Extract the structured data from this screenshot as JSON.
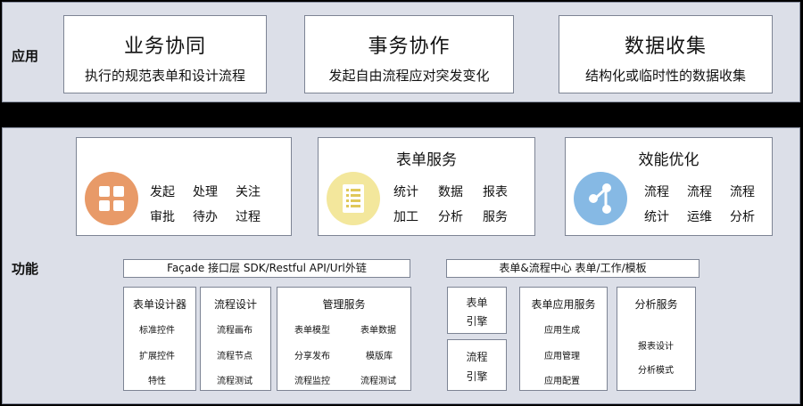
{
  "application": {
    "label": "应用",
    "cards": [
      {
        "title": "业务协同",
        "subtitle": "执行的规范表单和设计流程"
      },
      {
        "title": "事务协作",
        "subtitle": "发起自由流程应对突发变化"
      },
      {
        "title": "数据收集",
        "subtitle": "结构化或临时性的数据收集"
      }
    ]
  },
  "function": {
    "label": "功能",
    "cards": [
      {
        "title": "",
        "icon": "grid-icon",
        "color": "#e89a68",
        "items": [
          "发起",
          "处理",
          "关注",
          "审批",
          "待办",
          "过程"
        ]
      },
      {
        "title": "表单服务",
        "icon": "form-list-icon",
        "color": "#f3e79c",
        "items": [
          "统计",
          "数据",
          "报表",
          "加工",
          "分析",
          "服务"
        ]
      },
      {
        "title": "效能优化",
        "icon": "flow-nodes-icon",
        "color": "#86b9e4",
        "items": [
          "流程",
          "流程",
          "流程",
          "统计",
          "运维",
          "分析"
        ]
      }
    ],
    "left_header": "Façade 接口层   SDK/Restful API/Url外链",
    "right_header": "表单&流程中心   表单/工作/模板",
    "form_designer": {
      "title": "表单设计器",
      "items": [
        "标准控件",
        "扩展控件",
        "特性"
      ]
    },
    "flow_design": {
      "title": "流程设计",
      "items": [
        "流程画布",
        "流程节点",
        "流程测试"
      ]
    },
    "management": {
      "title": "管理服务",
      "items": [
        "表单模型",
        "表单数据",
        "分享发布",
        "模版库",
        "流程监控",
        "流程测试"
      ]
    },
    "form_engine": {
      "line1": "表单",
      "line2": "引擎"
    },
    "flow_engine": {
      "line1": "流程",
      "line2": "引擎"
    },
    "form_app": {
      "title": "表单应用服务",
      "items": [
        "应用生成",
        "应用管理",
        "应用配置"
      ]
    },
    "analysis": {
      "title": "分析服务",
      "items": [
        "报表设计",
        "分析模式"
      ]
    }
  }
}
